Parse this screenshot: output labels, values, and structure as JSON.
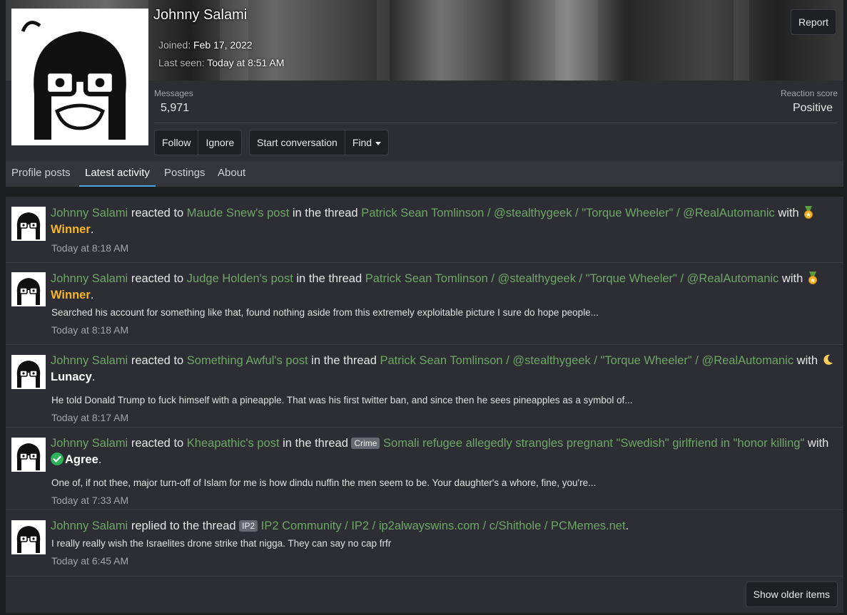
{
  "profile": {
    "username": "Johnny Salami",
    "joined_label": "Joined:",
    "joined_value": "Feb 17, 2022",
    "last_seen_label": "Last seen:",
    "last_seen_value": "Today at 8:51 AM",
    "report_label": "Report",
    "messages_label": "Messages",
    "messages_value": "5,971",
    "reaction_label": "Reaction score",
    "reaction_value": "Positive",
    "buttons": {
      "follow": "Follow",
      "ignore": "Ignore",
      "start_conversation": "Start conversation",
      "find": "Find"
    }
  },
  "tabs": [
    {
      "label": "Profile posts"
    },
    {
      "label": "Latest activity",
      "active": true
    },
    {
      "label": "Postings"
    },
    {
      "label": "About"
    }
  ],
  "feed": {
    "items": [
      {
        "user": "Johnny Salami",
        "verb": " reacted to ",
        "post": "Maude Snew's post",
        "mid": " in the thread ",
        "thread": "Patrick Sean Tomlinson / @stealthygeek / \"Torque Wheeler\" / @RealAutomanic",
        "with": " with ",
        "reaction": "Winner",
        "end": ".",
        "time": "Today at 8:18 AM"
      },
      {
        "user": "Johnny Salami",
        "verb": " reacted to ",
        "post": "Judge Holden's post",
        "mid": " in the thread ",
        "thread": "Patrick Sean Tomlinson / @stealthygeek / \"Torque Wheeler\" / @RealAutomanic",
        "with": " with ",
        "reaction": "Winner",
        "end": ".",
        "snippet": "Searched his account for something like that, found nothing aside from this extremely exploitable picture I sure do hope people...",
        "time": "Today at 8:18 AM"
      },
      {
        "user": "Johnny Salami",
        "verb": " reacted to ",
        "post": "Something Awful's post",
        "mid": " in the thread ",
        "thread": "Patrick Sean Tomlinson / @stealthygeek / \"Torque Wheeler\" / @RealAutomanic",
        "with": " with ",
        "reaction": "Lunacy",
        "end": ".",
        "snippet": "He told Donald Trump to fuck himself with a pineapple. That was his first twitter ban, and since then he sees pineapples as a symbol of...",
        "time": "Today at 8:17 AM"
      },
      {
        "user": "Johnny Salami",
        "verb": " reacted to ",
        "post": "Kheapathic's post",
        "mid": " in the thread ",
        "prefix": "Crime",
        "thread": "Somali refugee allegedly strangles pregnant \"Swedish\" girlfriend in \"honor killing\"",
        "with": " with ",
        "reaction": "Agree",
        "end": ".",
        "snippet": "One of, if not thee, major turn-off of Islam for me is how dindu nuffin the men seem to be. Your daughter's a whore, fine, you're...",
        "time": "Today at 7:33 AM"
      },
      {
        "user": "Johnny Salami",
        "verb": " replied to the thread ",
        "prefix": "IP2",
        "thread": "IP2 Community / IP2 / ip2alwayswins.com / c/Shithole / PCMemes.net",
        "end": ".",
        "snippet": "I really really wish the Israelites drone strike that nigga. They can say no cap frfr",
        "time": "Today at 6:45 AM"
      }
    ],
    "show_older_label": "Show older items"
  }
}
